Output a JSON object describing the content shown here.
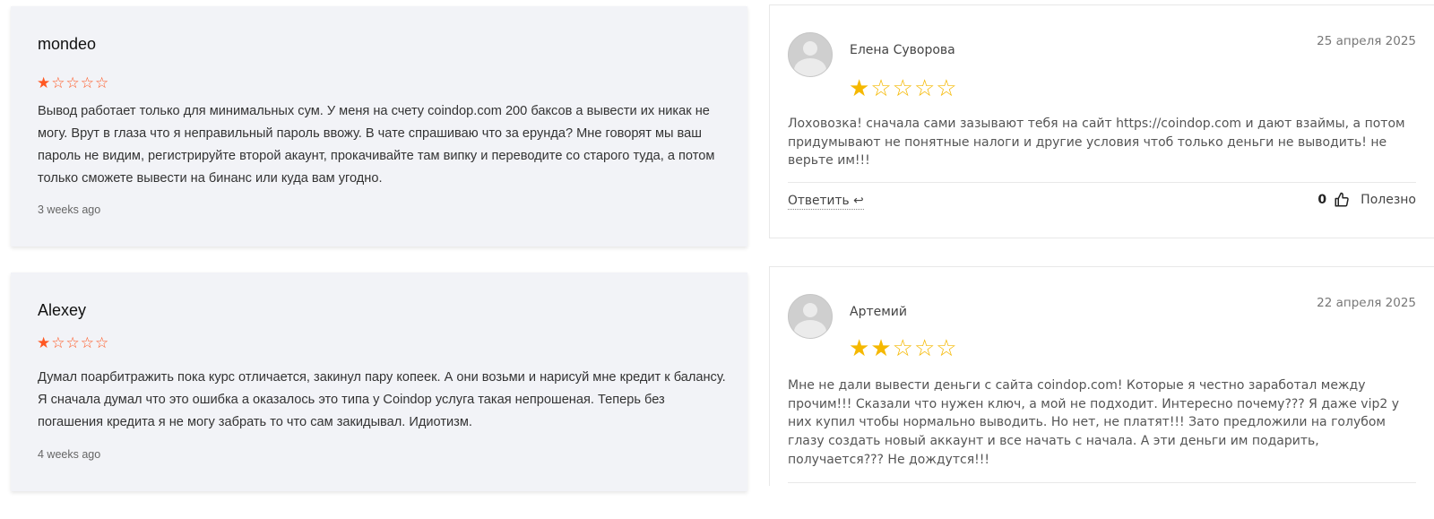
{
  "left_reviews": [
    {
      "author": "mondeo",
      "rating": 1,
      "stars": [
        "★",
        "☆",
        "☆",
        "☆",
        "☆"
      ],
      "text": "Вывод работает только для минимальных сум. У меня на счету coindop.com 200 баксов а вывести их никак не могу. Врут в глаза что я неправильный пароль ввожу. В чате спрашиваю что за ерунда? Мне говорят мы ваш пароль не видим, регистрируйте второй акаунт, прокачивайте там випку и переводите со старого туда, а потом только сможете вывести на бинанс или куда вам угодно.",
      "date": "3 weeks ago"
    },
    {
      "author": "Alexey",
      "rating": 1,
      "stars": [
        "★",
        "☆",
        "☆",
        "☆",
        "☆"
      ],
      "text": "Думал поарбитражить пока курс отличается, закинул пару копеек. А они возьми и нарисуй мне кредит к балансу. Я сначала думал что это ошибка а оказалось это типа у Coindop услуга такая непрошеная. Теперь без погашения кредита я не могу забрать то что сам закидывал. Идиотизм.",
      "date": "4 weeks ago"
    }
  ],
  "right_reviews": [
    {
      "author": "Елена Суворова",
      "date": "25 апреля 2025",
      "rating": 1,
      "stars": [
        "★",
        "☆",
        "☆",
        "☆",
        "☆"
      ],
      "text": "Лоховозка! сначала сами зазывают тебя на сайт https://coindop.com и дают взаймы, а потом придумывают не понятные налоги и другие условия чтоб только деньги не выводить! не верьте им!!!",
      "reply_label": "Ответить",
      "useful_count": "0",
      "useful_label": "Полезно"
    },
    {
      "author": "Артемий",
      "date": "22 апреля 2025",
      "rating": 2,
      "stars": [
        "★",
        "★",
        "☆",
        "☆",
        "☆"
      ],
      "text": "Мне не дали вывести деньги с сайта coindop.com! Которые я честно заработал между прочим!!! Сказали что нужен ключ, а мой не подходит. Интересно почему??? Я даже vip2 у них купил чтобы нормально выводить. Но нет, не платят!!! Зато предложили на голубом глазу создать новый аккаунт и все начать с начала. А эти деньги им подарить, получается??? Не дождутся!!!"
    }
  ],
  "icons": {
    "reply": "reply-arrow-icon",
    "useful": "thumbs-up-icon",
    "avatar": "user-avatar-icon"
  },
  "colors": {
    "left_star": "#ff5722",
    "right_star": "#f5b800",
    "left_card_bg": "#f2f3f7"
  }
}
